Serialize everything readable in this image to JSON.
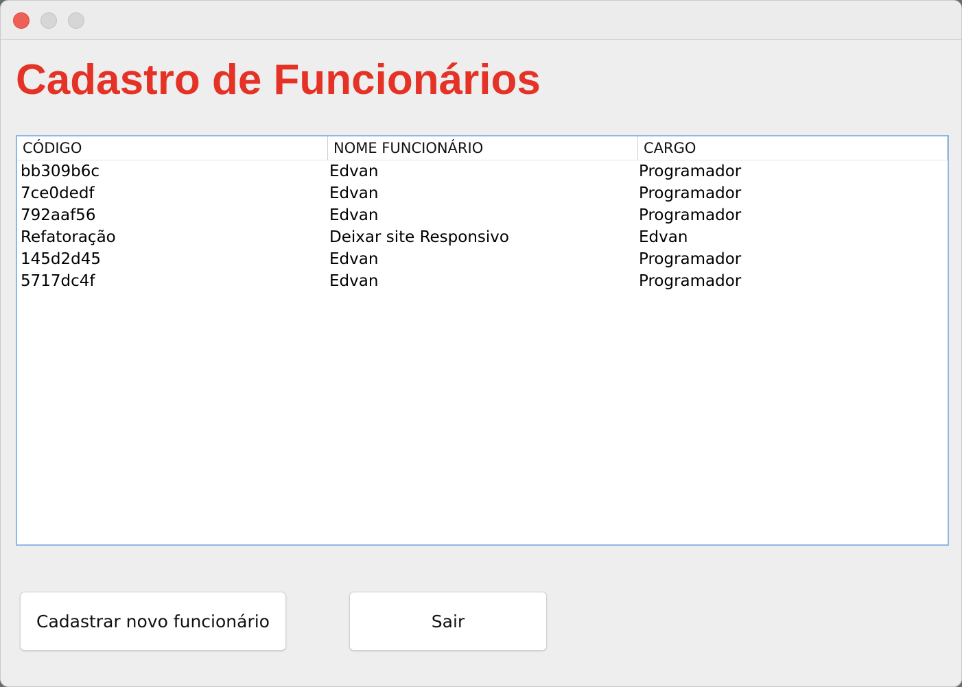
{
  "window": {
    "title": "Cadastro de Funcionários"
  },
  "table": {
    "headers": [
      "CÓDIGO",
      "NOME FUNCIONÁRIO",
      "CARGO"
    ],
    "rows": [
      [
        "bb309b6c",
        "Edvan",
        "Programador"
      ],
      [
        "7ce0dedf",
        "Edvan",
        "Programador"
      ],
      [
        "792aaf56",
        "Edvan",
        "Programador"
      ],
      [
        "Refatoração",
        "Deixar site Responsivo",
        "Edvan"
      ],
      [
        "145d2d45",
        "Edvan",
        "Programador"
      ],
      [
        "5717dc4f",
        "Edvan",
        "Programador"
      ]
    ]
  },
  "buttons": {
    "add_label": "Cadastrar novo funcionário",
    "exit_label": "Sair"
  },
  "colors": {
    "title": "#e53226",
    "table_focus_border": "#8db8e6",
    "close_button": "#ee5f57"
  }
}
